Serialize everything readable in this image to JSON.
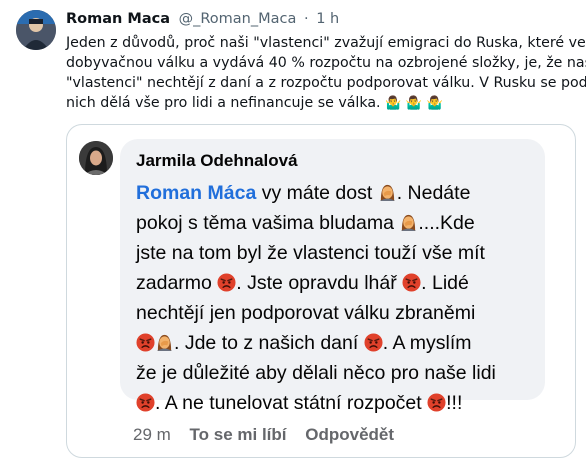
{
  "tweet": {
    "author_name": "Roman Maca",
    "handle": "@_Roman_Maca",
    "separator": "·",
    "time": "1 h",
    "text_lines": [
      "Jeden z důvodů, proč naši \"vlastenci\" zvažují emigraci do Ruska, které vede",
      "dobyvačnou válku a vydává 40 % rozpočtu na ozbrojené složky, je, že naši",
      "\"vlastenci\" nechtějí z daní a z rozpočtu podporovat válku. V Rusku se podle",
      "nich dělá vše pro lidi a nefinancuje se válka."
    ],
    "trailing_emoji": [
      "🤷‍♂️",
      "🤷‍♂️",
      "🤷‍♂️"
    ],
    "avatar_icon": "profile-photo",
    "colors": {
      "text": "#0f1419",
      "secondary": "#536471",
      "border": "#cfd9de"
    }
  },
  "quoted_comment": {
    "author_name": "Jarmila Odehnalová",
    "mention": "Roman Máca",
    "segments": {
      "l1_after_mention": " vy máte dost ",
      "l2a": "Nedáte",
      "l2b": "pokoj s těma vašima bludama ",
      "l2c": "....Kde",
      "l3": "jste na tom byl že vlastenci touží vše mít",
      "l4a": "zadarmo ",
      "l4b": ". Jste opravdu lhář ",
      "l4c": ". Lidé",
      "l5": "nechtějí jen podporovat válku zbraněmi",
      "l6a": ". Jde to z našich daní ",
      "l6b": ". A myslím",
      "l7": "že je důležité aby dělali něco pro naše lidi",
      "l8a": ". A ne tunelovat státní rozpočet ",
      "l8b": "!!!"
    },
    "emoji": {
      "facepalm": "woman-facepalming-icon",
      "angry": "angry-face-icon"
    },
    "time": "29 m",
    "like_label": "To se mi líbí",
    "reply_label": "Odpovědět",
    "colors": {
      "bubble": "#f0f2f5",
      "mention": "#216fdb",
      "meta": "#65676b",
      "angry": "#e0412b"
    }
  }
}
